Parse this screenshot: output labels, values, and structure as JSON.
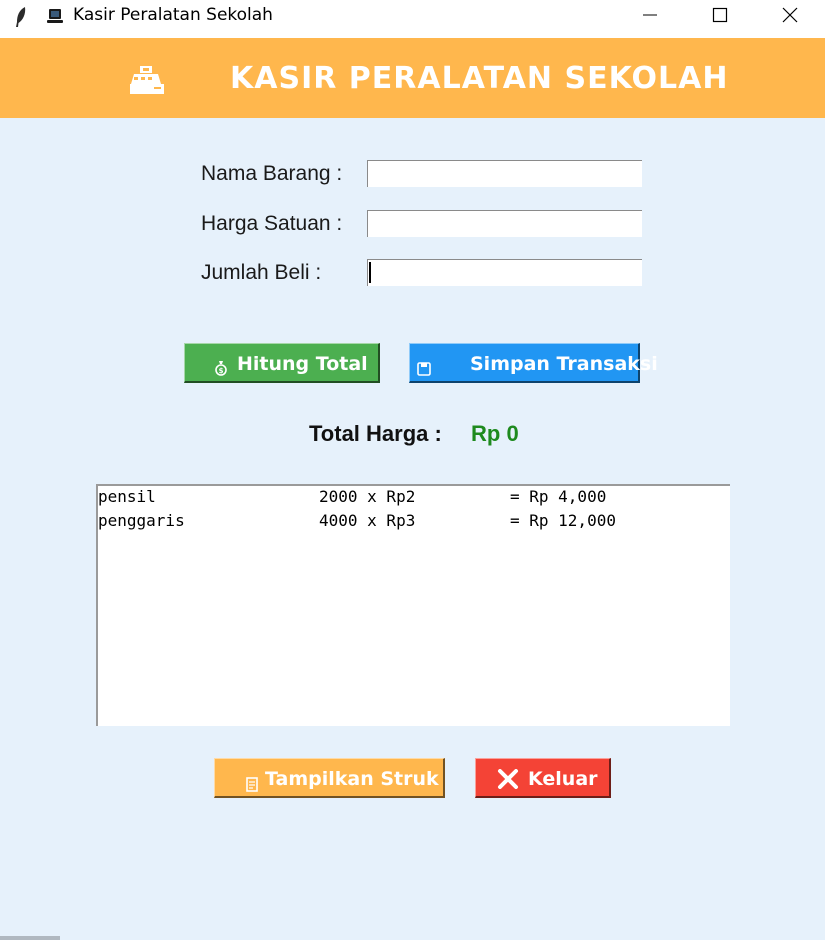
{
  "window": {
    "title": "Kasir Peralatan Sekolah",
    "icons": [
      "feather-icon",
      "laptop-icon"
    ],
    "controls": [
      "minimize-icon",
      "maximize-icon",
      "close-icon"
    ]
  },
  "header": {
    "title": "KASIR PERALATAN SEKOLAH",
    "icon": "cash-register-icon",
    "bg_color": "#ffb74d"
  },
  "form": {
    "nama_barang": {
      "label": "Nama Barang :",
      "value": ""
    },
    "harga_satuan": {
      "label": "Harga Satuan :",
      "value": ""
    },
    "jumlah_beli": {
      "label": "Jumlah Beli :",
      "value": ""
    }
  },
  "buttons": {
    "hitung": {
      "label": "Hitung Total",
      "icon": "money-bag-icon",
      "color": "#4caf50"
    },
    "simpan": {
      "label": "Simpan Transaksi",
      "icon": "floppy-disk-icon",
      "color": "#2196f3"
    },
    "struk": {
      "label": "Tampilkan Struk",
      "icon": "receipt-icon",
      "color": "#ffb74d"
    },
    "keluar": {
      "label": "Keluar",
      "icon": "close-x-icon",
      "color": "#f44336"
    }
  },
  "total": {
    "label": "Total Harga :",
    "value": "Rp 0",
    "value_color": "#1e8a1e"
  },
  "receipt": {
    "lines": [
      {
        "item": "pensil",
        "qty_price": "2000 x Rp2",
        "subtotal": "= Rp 4,000"
      },
      {
        "item": "penggaris",
        "qty_price": "4000 x Rp3",
        "subtotal": "= Rp 12,000"
      }
    ]
  }
}
